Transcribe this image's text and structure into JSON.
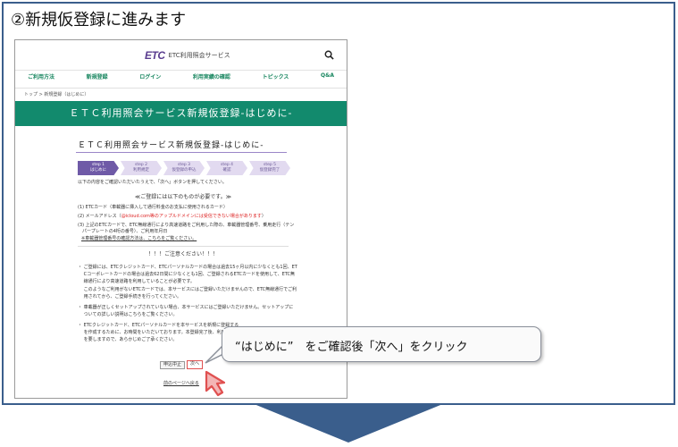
{
  "step_title": "②新規仮登録に進みます",
  "callout": "“はじめに”　をご確認後「次へ」をクリック",
  "site": {
    "logo_mark": "ETC",
    "logo_text": "ETC利用照会サービス",
    "nav": [
      "ご利用方法",
      "新規登録",
      "ログイン",
      "利用実績の確認",
      "トピックス",
      "Q&A"
    ],
    "breadcrumb": "トップ > 新規登録（はじめに）",
    "banner": "ＥＴＣ利用照会サービス新規仮登録-はじめに-",
    "page_heading": "ＥＴＣ利用照会サービス新規仮登録-はじめに-",
    "steps": [
      {
        "no": "step 1",
        "label": "はじめに"
      },
      {
        "no": "step 2",
        "label": "利用規定"
      },
      {
        "no": "step 3",
        "label": "仮登録の申込"
      },
      {
        "no": "step 4",
        "label": "確認"
      },
      {
        "no": "step 5",
        "label": "仮登録完了"
      }
    ],
    "intro": "以下の内容をご確認いただいたうえで、「次へ」ボタンを押してください。",
    "required_heading": "≪ご登録には以下のものが必要です。≫",
    "req1": "(1) ETCカード（車載器に挿入して通行料金のお支払に使用されるカード）",
    "req2a": "(2) メールアドレス（",
    "req2b": "@icloud.com等のアップルドメインには受信できない場合があります",
    "req2c": "）",
    "req3a": "(3) 上記のETCカードで、ETC無線通行により高速道路をご利用した際の、車載器管理番号、乗用走行（テン",
    "req3b": "　パープレートの4桁の番号）、ご利用年月日",
    "req3c": "※車載器管理番号の確認方法は、こちらをご覧ください。",
    "caution_heading": "！！！ご注意ください！！！",
    "caution": [
      "・ ご登録には、ETCクレジットカード、ETCパーソナルカードの場合は過去15ヶ月以内に少なくとも1回、ET",
      "　 Cコーポレートカードの場合は過去62日間に少なくとも1回、ご登録されるETCカードを使用して、ETC無",
      "　 線通行により高速道路を利用していることが必要です。",
      "　 このようなご利用がないETCカードでは、本サービスにはご登録いただけませんので、ETC無線通行でご利",
      "　 用されてから、ご登録手続きを行ってください。",
      "・ 車載器が正しくセットアップされていない場合、本サービスにはご登録いただけません。セットアップに",
      "　 ついての詳しい説明はこちらをご覧ください。",
      "・ ETCクレジットカード、ETCパーソナルカードを本サービスを新規に登録する",
      "　 を作成するために、お時間をいただいております。本登録完了後、利用明",
      "　 を要しますので、あらかじめご了承ください。"
    ],
    "btn_cancel": "申込中止",
    "btn_next": "次へ",
    "back_link": "前のページへ戻る"
  },
  "colors": {
    "frame": "#3a5e8c",
    "brand_green": "#128a6d",
    "nav_green": "#16855e",
    "step_active": "#6f5aa7",
    "step_inactive": "#e2daf0",
    "warn_red": "#d22222",
    "pointer_red": "#e05050"
  }
}
